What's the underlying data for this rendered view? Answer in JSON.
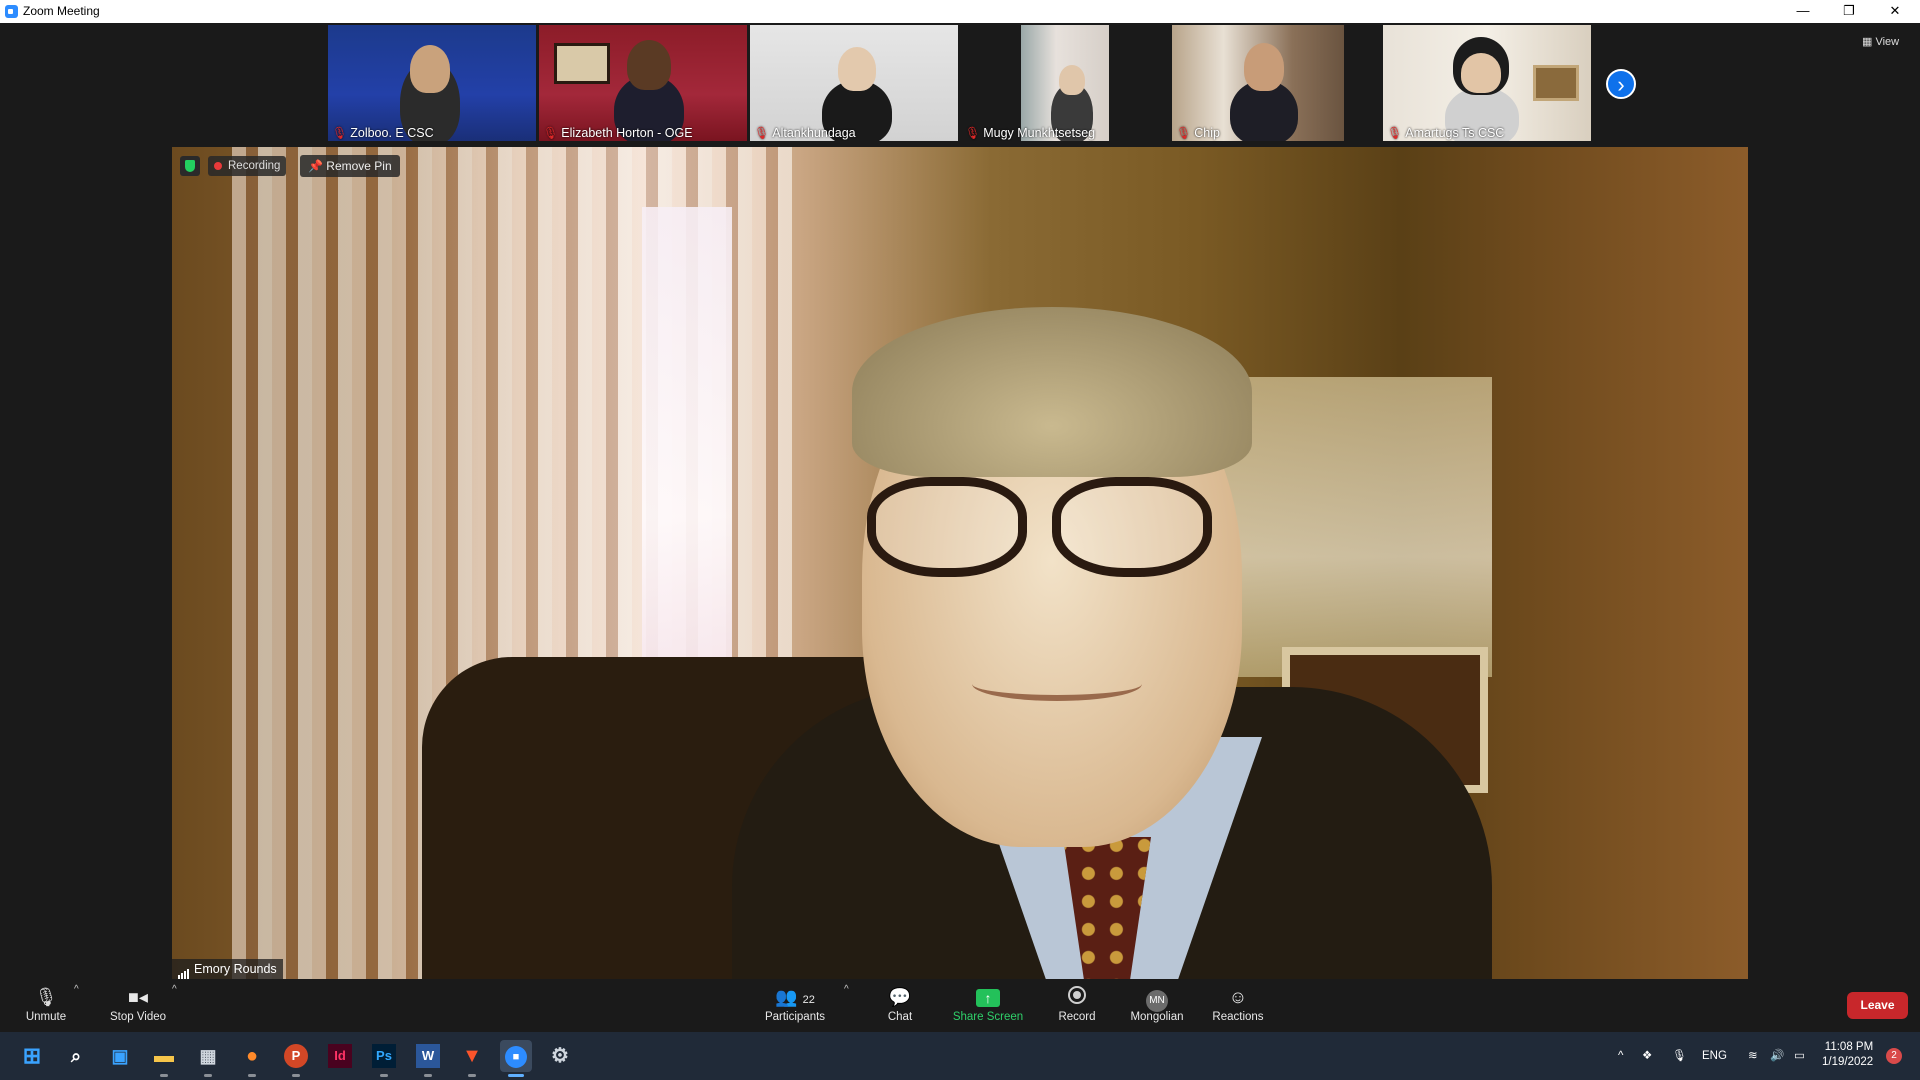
{
  "window": {
    "title": "Zoom Meeting",
    "minimize": "—",
    "restore": "❐",
    "close": "✕"
  },
  "gallery": {
    "view_label": "View",
    "next_icon": "›",
    "thumbnails": [
      {
        "name": "Zolboo. E CSC",
        "muted": true
      },
      {
        "name": "Elizabeth Horton - OGE",
        "muted": true
      },
      {
        "name": "Altankhundaga",
        "muted": true
      },
      {
        "name": "Mugy Munkhtsetseg",
        "muted": true
      },
      {
        "name": "Chip",
        "muted": true
      },
      {
        "name": "Amartugs Ts CSC",
        "muted": true
      }
    ]
  },
  "main_video": {
    "speaker_name": "Emory Rounds",
    "recording_label": "Recording",
    "remove_pin_label": "Remove Pin"
  },
  "controls": {
    "unmute": "Unmute",
    "stop_video": "Stop Video",
    "participants": "Participants",
    "participants_count": "22",
    "chat": "Chat",
    "share_screen": "Share Screen",
    "record": "Record",
    "mongolian": "Mongolian",
    "mongolian_initials": "MN",
    "reactions": "Reactions",
    "leave": "Leave"
  },
  "taskbar": {
    "language": "ENG",
    "time": "11:08 PM",
    "date": "1/19/2022",
    "notification_count": "2",
    "apps": [
      "start-icon",
      "search-icon",
      "widgets-icon",
      "file-explorer-icon",
      "calculator-icon",
      "firefox-icon",
      "powerpoint-icon",
      "indesign-icon",
      "photoshop-icon",
      "word-icon",
      "brave-icon",
      "zoom-icon",
      "settings-icon"
    ],
    "labels": {
      "indesign": "Id",
      "photoshop": "Ps",
      "word": "W",
      "powerpoint": "P"
    }
  },
  "colors": {
    "accent_blue": "#0e71eb",
    "leave_red": "#c8272b",
    "share_green": "#23c15a",
    "muted_red": "#e02828"
  }
}
